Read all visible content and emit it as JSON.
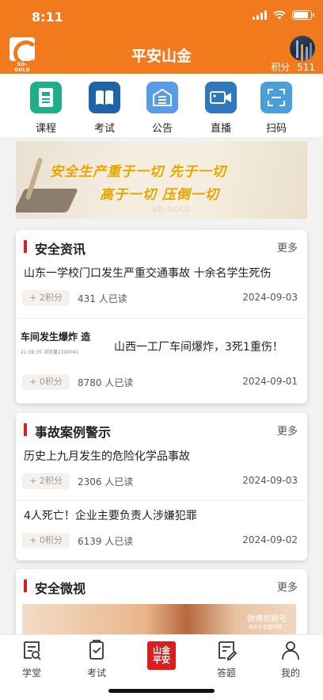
{
  "status_bar": {
    "time": "8:11"
  },
  "header": {
    "logo_text": "SD-GOLD",
    "title": "平安山金",
    "points_label": "积分",
    "points_value": "511"
  },
  "quick_nav": [
    {
      "label": "课程",
      "icon": "course-book-icon",
      "color": "#1fae8a"
    },
    {
      "label": "考试",
      "icon": "open-book-icon",
      "color": "#1f63a8"
    },
    {
      "label": "公告",
      "icon": "notice-icon",
      "color": "#5a9be8"
    },
    {
      "label": "直播",
      "icon": "video-camera-icon",
      "color": "#2f77bf"
    },
    {
      "label": "扫码",
      "icon": "scan-icon",
      "color": "#4a9fd8"
    }
  ],
  "banner": {
    "line1": "安全生产重于一切 先于一切",
    "line2": "高于一切 压倒一切",
    "watermark": "SD-GOLD"
  },
  "sections": [
    {
      "title": "安全资讯",
      "more": "更多",
      "items": [
        {
          "title": "山东一学校门口发生严重交通事故 十余名学生死伤",
          "points": "+ 2积分",
          "reads": "431 人已读",
          "date": "2024-09-03"
        },
        {
          "title": "山西一工厂车间爆炸，3死1重伤！",
          "thumb_title": "车间发生爆炸 造",
          "thumb_sub": "21:38:35 浏览量2300041",
          "points": "+ 0积分",
          "reads": "8780 人已读",
          "date": "2024-09-01"
        }
      ]
    },
    {
      "title": "事故案例警示",
      "more": "更多",
      "items": [
        {
          "title": "历史上九月发生的危险化学品事故",
          "points": "+ 2积分",
          "reads": "2306 人已读",
          "date": "2024-09-03"
        },
        {
          "title": "4人死亡！企业主要负责人涉嫌犯罪",
          "points": "+ 0积分",
          "reads": "6139 人已读",
          "date": "2024-09-02"
        }
      ]
    },
    {
      "title": "安全微视",
      "more": "更多",
      "video_watermark": "微博视频号",
      "video_watermark_sub": "某安全监管视频"
    }
  ],
  "tabbar": [
    {
      "label": "学堂",
      "icon": "study-icon"
    },
    {
      "label": "考试",
      "icon": "exam-icon"
    },
    {
      "label": "山金平安",
      "icon": "center-logo-icon"
    },
    {
      "label": "答题",
      "icon": "quiz-icon"
    },
    {
      "label": "我的",
      "icon": "profile-icon"
    }
  ],
  "colors": {
    "brand": "#f07a1c",
    "accent_red": "#e01e1e"
  }
}
